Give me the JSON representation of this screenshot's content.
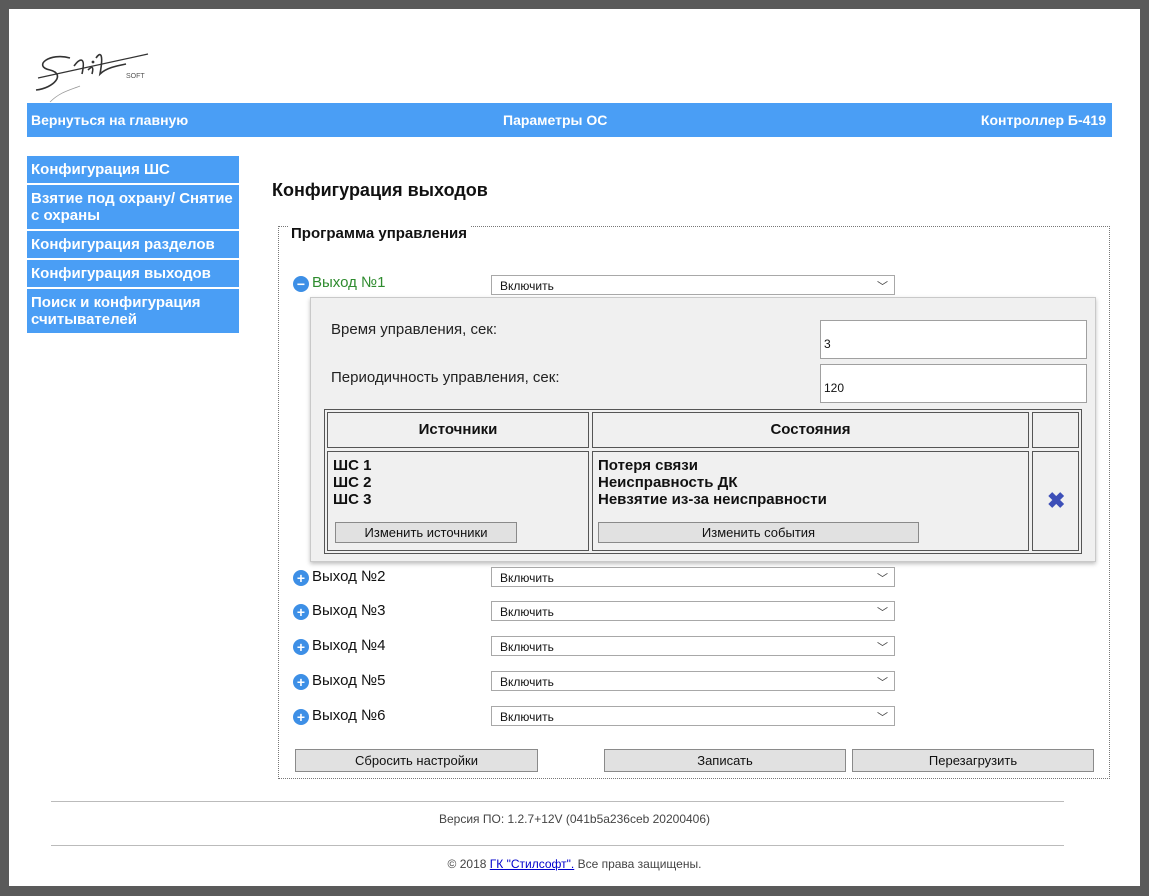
{
  "header": {
    "home_link": "Вернуться на главную",
    "page_section": "Параметры ОС",
    "device": "Контроллер Б-419"
  },
  "sidebar": {
    "items": [
      {
        "label": "Конфигурация ШС"
      },
      {
        "label": "Взятие под охрану/ Снятие с охраны"
      },
      {
        "label": "Конфигурация разделов"
      },
      {
        "label": "Конфигурация выходов"
      },
      {
        "label": "Поиск и конфигурация считывателей"
      }
    ]
  },
  "main": {
    "title": "Конфигурация выходов",
    "group_legend": "Программа управления",
    "outputs": [
      {
        "label": "Выход №1",
        "mode": "Включить",
        "expanded": true
      },
      {
        "label": "Выход №2",
        "mode": "Включить",
        "expanded": false
      },
      {
        "label": "Выход №3",
        "mode": "Включить",
        "expanded": false
      },
      {
        "label": "Выход №4",
        "mode": "Включить",
        "expanded": false
      },
      {
        "label": "Выход №5",
        "mode": "Включить",
        "expanded": false
      },
      {
        "label": "Выход №6",
        "mode": "Включить",
        "expanded": false
      }
    ],
    "details": {
      "time_label": "Время управления, сек:",
      "time_value": "3",
      "period_label": "Периодичность управления, сек:",
      "period_value": "120",
      "table": {
        "col_sources": "Источники",
        "col_states": "Состояния",
        "sources": [
          "ШС 1",
          "ШС 2",
          "ШС 3"
        ],
        "states": [
          "Потеря связи",
          "Неисправность ДК",
          "Невзятие из-за неисправности"
        ],
        "change_sources_btn": "Изменить источники",
        "change_events_btn": "Изменить события"
      }
    },
    "buttons": {
      "reset": "Сбросить настройки",
      "write": "Записать",
      "reboot": "Перезагрузить"
    }
  },
  "footer": {
    "version": "Версия ПО: 1.2.7+12V (041b5a236ceb 20200406)",
    "copyright_prefix": "© 2018",
    "company_link": "ГК \"Стилсофт\".",
    "copyright_suffix": "Все права защищены."
  },
  "colors": {
    "accent": "#4a9ef5",
    "active_output": "#2e8b2e",
    "delete_icon": "#3d4fb8"
  }
}
